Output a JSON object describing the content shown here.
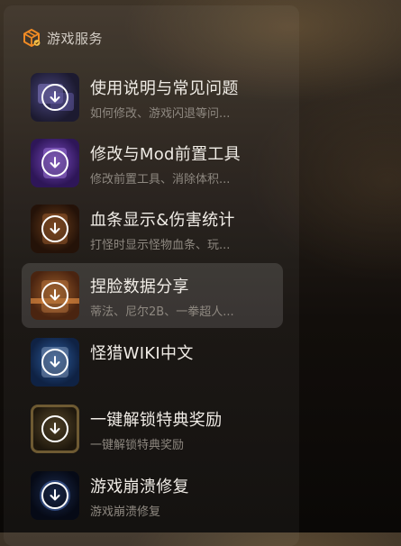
{
  "header": {
    "title": "游戏服务",
    "icon": "box-icon",
    "accent": "#f08a24"
  },
  "items": [
    {
      "title": "使用说明与常见问题",
      "subtitle": "如何修改、游戏闪退等问...",
      "icon": "download-icon",
      "thumb_color": "#2a2748"
    },
    {
      "title": "修改与Mod前置工具",
      "subtitle": "修改前置工具、消除体积...",
      "icon": "download-icon",
      "thumb_color": "#4b2a7a"
    },
    {
      "title": "血条显示&伤害统计",
      "subtitle": "打怪时显示怪物血条、玩...",
      "icon": "download-icon",
      "thumb_color": "#4a2b14"
    },
    {
      "title": "捏脸数据分享",
      "subtitle": "蒂法、尼尔2B、一拳超人...",
      "icon": "download-icon",
      "thumb_color": "#6b3b1c",
      "active": true
    },
    {
      "title": "怪猎WIKI中文",
      "subtitle": "",
      "icon": "download-icon",
      "thumb_color": "#1d3a66"
    },
    {
      "title": "一键解锁特典奖励",
      "subtitle": "一键解锁特典奖励",
      "icon": "download-icon",
      "thumb_color": "#3a2e18"
    },
    {
      "title": "游戏崩溃修复",
      "subtitle": "游戏崩溃修复",
      "icon": "download-icon",
      "thumb_color": "#0f1a30"
    }
  ]
}
